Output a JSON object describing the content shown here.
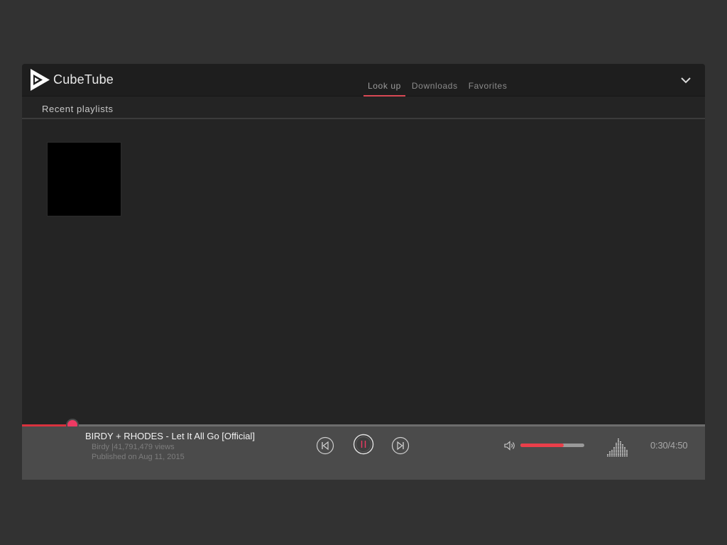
{
  "app": {
    "name": "CubeTube",
    "accent_color": "#d94854"
  },
  "nav": {
    "tabs": [
      {
        "label": "Look up",
        "active": true
      },
      {
        "label": "Downloads",
        "active": false
      },
      {
        "label": "Favorites",
        "active": false
      }
    ],
    "menu_icon": "chevron-down-icon"
  },
  "section": {
    "title": "Recent playlists"
  },
  "playlists": [
    {
      "thumbnail_color": "#000000"
    }
  ],
  "player": {
    "title": "BIRDY + RHODES - Let It All Go [Official]",
    "meta_line": "Birdy |41,791,479 views",
    "published": "Published on Aug 11, 2015",
    "state": "playing",
    "progress_fraction": 0.074,
    "volume_fraction": 0.68,
    "time": "0:30/4:50",
    "icons": {
      "prev": "skip-previous-icon",
      "play_pause": "pause-icon",
      "next": "skip-next-icon",
      "volume": "volume-icon",
      "equalizer": "equalizer-icon"
    }
  }
}
